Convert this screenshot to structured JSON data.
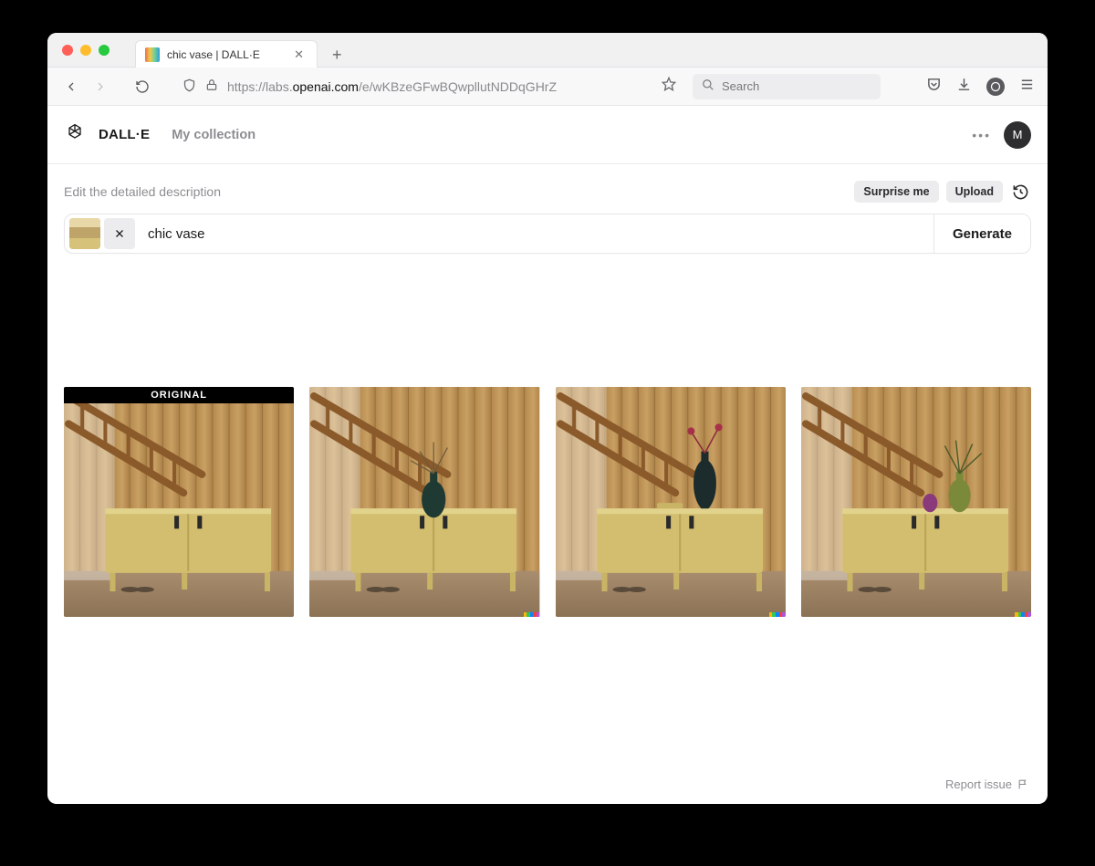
{
  "browser": {
    "tab_title": "chic vase | DALL·E",
    "url_prefix": "https://labs.",
    "url_host": "openai.com",
    "url_path": "/e/wKBzeGFwBQwpllutNDDqGHrZ",
    "search_placeholder": "Search"
  },
  "header": {
    "brand": "DALL·E",
    "collection": "My collection",
    "avatar_initial": "M"
  },
  "prompt": {
    "hint": "Edit the detailed description",
    "surprise": "Surprise me",
    "upload": "Upload",
    "input_value": "chic vase",
    "generate": "Generate"
  },
  "gallery": {
    "original_badge": "ORIGINAL",
    "watermark_colors": [
      "#ff6b00",
      "#ffd400",
      "#34c759",
      "#0a84ff",
      "#af52de"
    ]
  },
  "footer": {
    "report": "Report issue"
  }
}
